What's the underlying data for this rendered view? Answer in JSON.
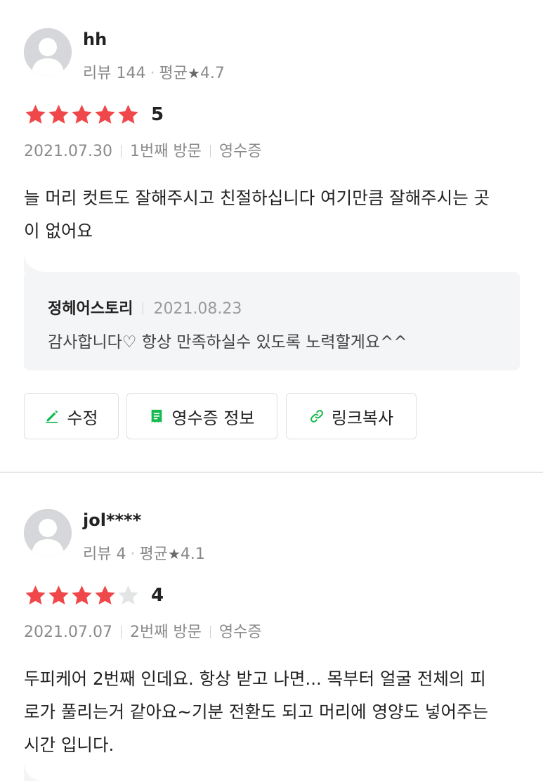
{
  "reviews": [
    {
      "nickname": "hh",
      "review_label": "리뷰 144",
      "avg_label": "평균",
      "avg_value": "4.7",
      "rating": 5,
      "score": "5",
      "date": "2021.07.30",
      "visit": "1번째 방문",
      "receipt": "영수증",
      "text_lines": [
        "늘 머리 컷트도 잘해주시고 친절하십니다 여기만큼 잘해주시는 곳",
        "이 없어요"
      ],
      "reply": {
        "owner": "정헤어스토리",
        "date": "2021.08.23",
        "text": "감사합니다♡ 항상 만족하실수 있도록 노력할게요^^"
      },
      "buttons": {
        "edit": "수정",
        "receipt_info": "영수증 정보",
        "copy_link": "링크복사"
      }
    },
    {
      "nickname": "jol****",
      "review_label": "리뷰 4",
      "avg_label": "평균",
      "avg_value": "4.1",
      "rating": 4,
      "score": "4",
      "date": "2021.07.07",
      "visit": "2번째 방문",
      "receipt": "영수증",
      "text_lines": [
        "두피케어 2번째 인데요. 항상 받고 나면... 목부터 얼굴 전체의 피",
        "로가 풀리는거 같아요~기분 전환도 되고 머리에 영양도 넣어주는",
        "시간 입니다."
      ]
    }
  ],
  "colors": {
    "star_filled": "#f0474b",
    "star_empty": "#e3e4e6",
    "accent_green": "#16b950",
    "reply_bg": "#f4f5f7"
  },
  "icons": {
    "edit": "pencil-icon",
    "receipt": "receipt-icon",
    "link": "link-icon",
    "avatar": "default-avatar-icon"
  }
}
